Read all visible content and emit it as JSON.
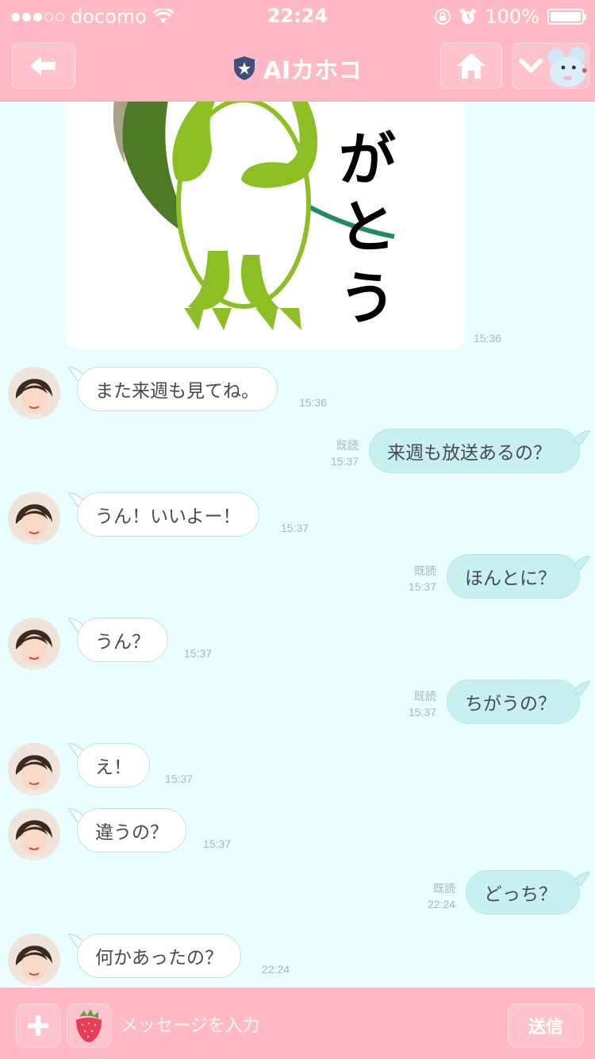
{
  "status_bar": {
    "carrier": "docomo",
    "time": "22:24",
    "battery": "100%"
  },
  "nav": {
    "title": "AIカホコ",
    "back_icon": "back-arrow-icon",
    "home_icon": "home-icon",
    "menu_icon": "chevron-down-icon"
  },
  "sticker": {
    "text": "がとう",
    "time": "15:36"
  },
  "messages": [
    {
      "side": "in",
      "text": "また来週も見てね。",
      "time": "15:36"
    },
    {
      "side": "out",
      "text": "来週も放送あるの？",
      "read": "既読",
      "time": "15:37"
    },
    {
      "side": "in",
      "text": "うん！いいよー！",
      "time": "15:37"
    },
    {
      "side": "out",
      "text": "ほんとに？",
      "read": "既読",
      "time": "15:37"
    },
    {
      "side": "in",
      "text": "うん？",
      "time": "15:37"
    },
    {
      "side": "out",
      "text": "ちがうの？",
      "read": "既読",
      "time": "15:37"
    },
    {
      "side": "in",
      "text": "え！",
      "time": "15:37"
    },
    {
      "side": "in",
      "text": "違うの？",
      "time": "15:37"
    },
    {
      "side": "out",
      "text": "どっち？",
      "read": "既読",
      "time": "22:24"
    },
    {
      "side": "in",
      "text": "何かあったの？",
      "time": "22:24"
    }
  ],
  "input": {
    "placeholder": "メッセージを入力",
    "send_label": "送信"
  },
  "colors": {
    "header_pink": "#ffb9c5",
    "chat_bg": "#eafeff",
    "outgoing_bubble": "#c9f0f1"
  }
}
